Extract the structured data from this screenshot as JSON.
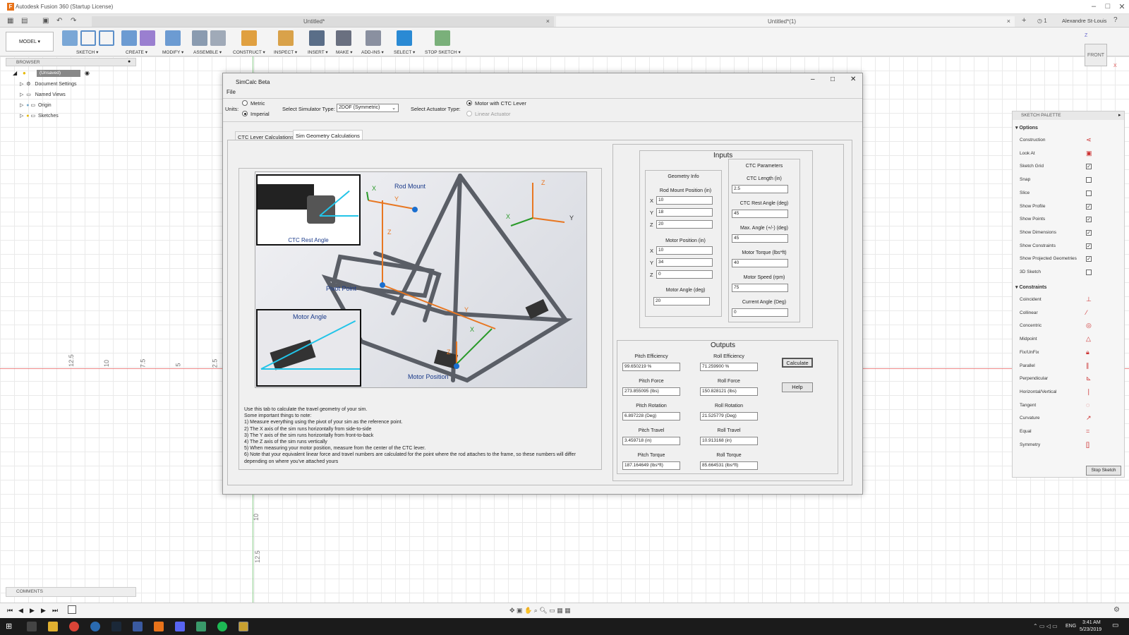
{
  "app": {
    "title": "Autodesk Fusion 360 (Startup License)",
    "tabs": [
      "Untitled*",
      "Untitled*(1)"
    ],
    "user": "Alexandre St-Louis",
    "jobs": "1"
  },
  "ribbon": {
    "workspace": "MODEL",
    "groups": [
      "SKETCH",
      "CREATE",
      "MODIFY",
      "ASSEMBLE",
      "CONSTRUCT",
      "INSPECT",
      "INSERT",
      "MAKE",
      "ADD-INS",
      "SELECT",
      "STOP SKETCH"
    ]
  },
  "browser": {
    "title": "BROWSER",
    "root": "(Unsaved)",
    "items": [
      "Document Settings",
      "Named Views",
      "Origin",
      "Sketches"
    ]
  },
  "comments": "COMMENTS",
  "rulers": {
    "h": [
      "12.5",
      "10",
      "7.5",
      "5",
      "2.5"
    ],
    "v": [
      "10",
      "12.5"
    ]
  },
  "viewcube": {
    "face": "FRONT",
    "z": "Z",
    "x": "X"
  },
  "palette": {
    "title": "SKETCH PALETTE",
    "options_title": "Options",
    "options": [
      {
        "label": "Construction"
      },
      {
        "label": "Look At"
      },
      {
        "label": "Sketch Grid",
        "checked": true
      },
      {
        "label": "Snap",
        "checked": false
      },
      {
        "label": "Slice",
        "checked": false
      },
      {
        "label": "Show Profile",
        "checked": true
      },
      {
        "label": "Show Points",
        "checked": true
      },
      {
        "label": "Show Dimensions",
        "checked": true
      },
      {
        "label": "Show Constraints",
        "checked": true
      },
      {
        "label": "Show Projected Geometries",
        "checked": true
      },
      {
        "label": "3D Sketch",
        "checked": false
      }
    ],
    "constraints_title": "Constraints",
    "constraints": [
      "Coincident",
      "Collinear",
      "Concentric",
      "Midpoint",
      "Fix/UnFix",
      "Parallel",
      "Perpendicular",
      "Horizontal/Vertical",
      "Tangent",
      "Curvature",
      "Equal",
      "Symmetry"
    ],
    "stop": "Stop Sketch"
  },
  "dialog": {
    "title": "SimCalc Beta",
    "menu": "File",
    "units_label": "Units:",
    "metric": "Metric",
    "imperial": "Imperial",
    "sim_type_label": "Select Simulator Type:",
    "sim_type": "2DOF (Symmetric)",
    "actuator_label": "Select Actuator Type:",
    "act1": "Motor with CTC Lever",
    "act2": "Linear Actuator",
    "tabs": [
      "CTC Lever Calculations",
      "Sim Geometry Calculations"
    ],
    "image_labels": {
      "rod_mount": "Rod Mount",
      "ctc_rest": "CTC Rest Angle",
      "pivot": "Pivot Point",
      "motor_angle": "Motor Angle",
      "motor_pos": "Motor Position",
      "x": "X",
      "y": "Y",
      "z": "Z"
    },
    "notes": [
      "Use this tab to calculate the travel geometry of your sim.",
      "Some important things to note:",
      "1) Measure everything using the pivot of your sim as the reference point.",
      "2) The X axis of the sim runs horizontally from side-to-side",
      "3) The Y axis of the sim runs horizontally from front-to-back",
      "4) The Z axis of the sim runs vertically",
      "5) When measuring your motor position, measure from the center of the CTC lever.",
      "6) Note that your equivalent linear force and travel numbers are calculated for the point where the rod attaches to the frame, so these numbers will differ",
      "    depending on where you've attached yours"
    ],
    "inputs": {
      "title": "Inputs",
      "geo_title": "Geometry Info",
      "rod_mount": "Rod Mount Position (in)",
      "rx": "10",
      "ry": "18",
      "rz": "20",
      "motor_pos": "Motor Position (in)",
      "mx": "10",
      "my": "34",
      "mz": "0",
      "motor_angle": "Motor Angle (deg)",
      "ma": "20",
      "ctc_title": "CTC Parameters",
      "ctc_len": "CTC Length (in)",
      "ctc_len_v": "2.5",
      "ctc_rest": "CTC Rest Angle (deg)",
      "ctc_rest_v": "45",
      "max_angle": "Max. Angle (+/-) (deg)",
      "max_angle_v": "45",
      "torque": "Motor Torque (lbs*ft)",
      "torque_v": "40",
      "speed": "Motor Speed (rpm)",
      "speed_v": "75",
      "cur_angle": "Current Angle (Deg)",
      "cur_angle_v": "0",
      "xl": "X",
      "yl": "Y",
      "zl": "Z"
    },
    "outputs": {
      "title": "Outputs",
      "rows": [
        {
          "l1": "Pitch Efficiency",
          "v1": "99.650219   %",
          "l2": "Roll Efficiency",
          "v2": "71.259900   %"
        },
        {
          "l1": "Pitch Force",
          "v1": "273.855095   (lbs)",
          "l2": "Roll Force",
          "v2": "150.828121   (lbs)"
        },
        {
          "l1": "Pitch Rotation",
          "v1": "6.897228   (Deg)",
          "l2": "Roll Rotation",
          "v2": "21.525779   (Deg)"
        },
        {
          "l1": "Pitch Travel",
          "v1": "3.459718   (in)",
          "l2": "Roll Travel",
          "v2": "10.913168   (in)"
        },
        {
          "l1": "Pitch Torque",
          "v1": "187.164649   (lbs*ft)",
          "l2": "Roll Torque",
          "v2": "85.664531   (lbs*ft)"
        }
      ],
      "calc": "Calculate",
      "help": "Help"
    }
  },
  "taskbar": {
    "time": "3:41 AM",
    "date": "5/23/2019",
    "lang": "ENG"
  }
}
